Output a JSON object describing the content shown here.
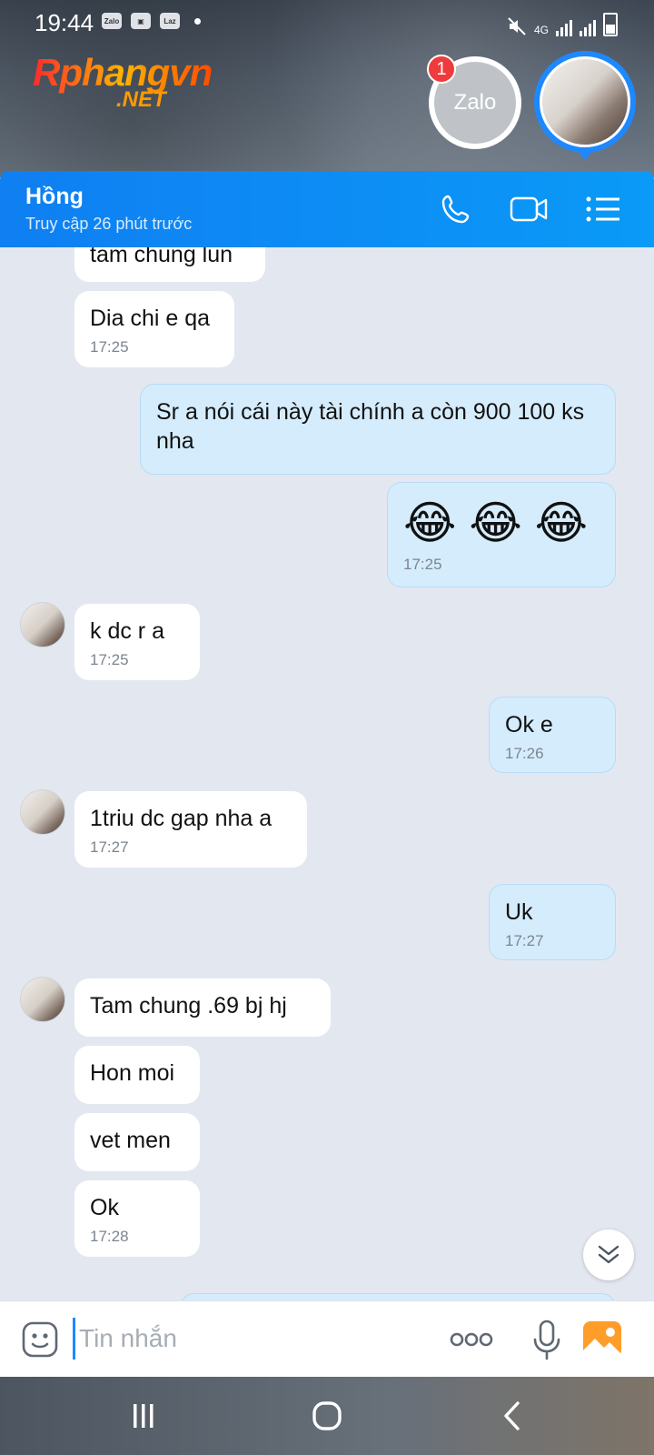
{
  "status_bar": {
    "time": "19:44",
    "notif_icons": [
      "Zalo",
      "image",
      "Laz"
    ],
    "network": "4G"
  },
  "watermark": {
    "main": "Rphangvn",
    "sub": ".NET"
  },
  "floating": {
    "zalo_label": "Zalo",
    "badge_count": "1"
  },
  "header": {
    "contact_name": "Hồng",
    "last_seen": "Truy cập 26 phút trước",
    "icons": [
      "phone-icon",
      "video-call-icon",
      "menu-list-icon"
    ]
  },
  "messages": [
    {
      "side": "in",
      "text": "tam chung lun",
      "time": ""
    },
    {
      "side": "in",
      "text": "Dia chi e qa",
      "time": "17:25"
    },
    {
      "side": "out",
      "text": "Sr a nói cái này tài chính a còn 900 100 ks nha",
      "time": ""
    },
    {
      "side": "out",
      "text": "😂 😂 😂",
      "time": "17:25"
    },
    {
      "side": "in",
      "text": "k dc  r a",
      "time": "17:25"
    },
    {
      "side": "out",
      "text": "Ok e",
      "time": "17:26"
    },
    {
      "side": "in",
      "text": "1triu dc gap nha a",
      "time": "17:27"
    },
    {
      "side": "out",
      "text": "Uk",
      "time": "17:27"
    },
    {
      "side": "in",
      "text": "Tam chung .69 bj hj",
      "time": ""
    },
    {
      "side": "in",
      "text": "Hon moi",
      "time": ""
    },
    {
      "side": "in",
      "text": "vet men",
      "time": ""
    },
    {
      "side": "in",
      "text": "Ok",
      "time": "17:28"
    }
  ],
  "input": {
    "placeholder": "Tin nhắn",
    "value": ""
  },
  "colors": {
    "header": "#0a8ef5",
    "outgoing_bubble": "#d5ecfc",
    "incoming_bubble": "#ffffff",
    "background": "#e3e8f0"
  }
}
